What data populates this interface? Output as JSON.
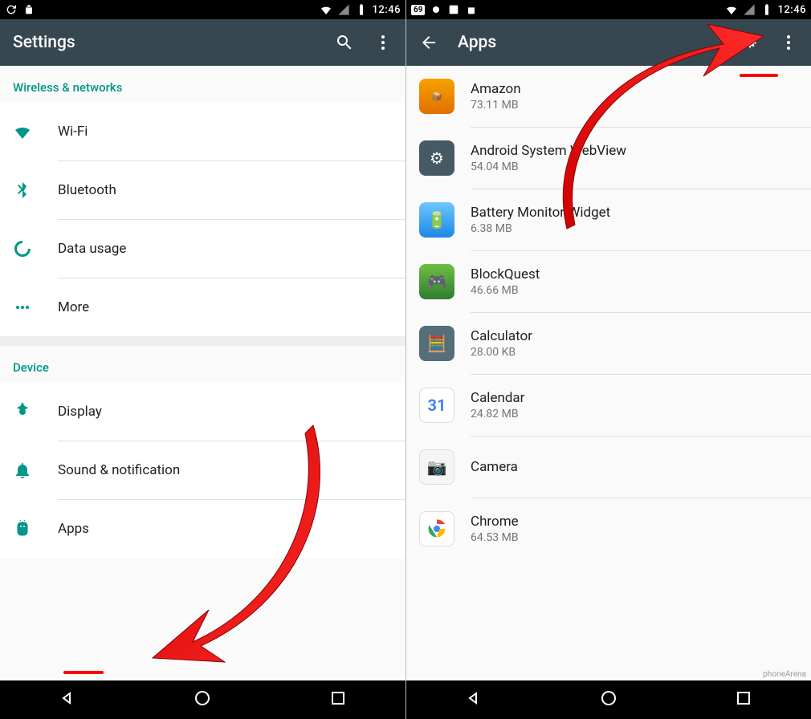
{
  "status": {
    "time": "12:46",
    "badge": "69"
  },
  "left": {
    "toolbar_title": "Settings",
    "section1": "Wireless & networks",
    "wifi": "Wi-Fi",
    "bluetooth": "Bluetooth",
    "data": "Data usage",
    "more": "More",
    "section2": "Device",
    "display": "Display",
    "sound": "Sound & notification",
    "apps": "Apps"
  },
  "right": {
    "toolbar_title": "Apps",
    "items": [
      {
        "name": "Amazon",
        "size": "73.11 MB"
      },
      {
        "name": "Android System WebView",
        "size": "54.04 MB"
      },
      {
        "name": "Battery Monitor Widget",
        "size": "6.38 MB"
      },
      {
        "name": "BlockQuest",
        "size": "46.66 MB"
      },
      {
        "name": "Calculator",
        "size": "28.00 KB"
      },
      {
        "name": "Calendar",
        "size": "24.82 MB"
      },
      {
        "name": "Camera",
        "size": ""
      },
      {
        "name": "Chrome",
        "size": "64.53 MB"
      }
    ]
  },
  "watermark": "phoneArena"
}
